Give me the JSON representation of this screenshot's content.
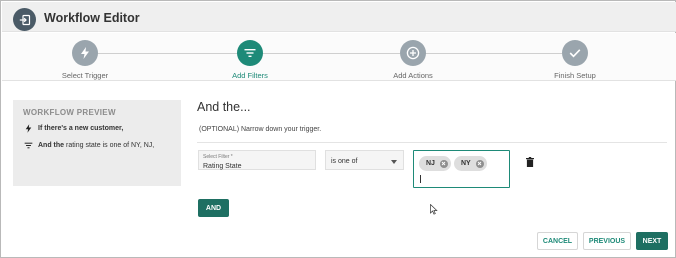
{
  "app": {
    "title": "Workflow Editor"
  },
  "stepper": {
    "steps": [
      {
        "label": "Select Trigger",
        "icon": "lightning-icon",
        "active": false
      },
      {
        "label": "Add Filters",
        "icon": "filter-icon",
        "active": true
      },
      {
        "label": "Add Actions",
        "icon": "plus-circle-icon",
        "active": false
      },
      {
        "label": "Finish Setup",
        "icon": "check-icon",
        "active": false
      }
    ]
  },
  "preview": {
    "title": "WORKFLOW PREVIEW",
    "trigger_text": "If there's a new customer,",
    "filter_prefix": "And the",
    "filter_text": "rating state is one of NY, NJ,"
  },
  "main": {
    "title": "And the...",
    "subtitle": "(OPTIONAL) Narrow down your trigger."
  },
  "filter": {
    "field_label": "Select Filter *",
    "field_value": "Rating State",
    "operator_value": "is one of",
    "chips": [
      "NJ",
      "NY"
    ]
  },
  "buttons": {
    "and": "AND",
    "cancel": "CANCEL",
    "previous": "PREVIOUS",
    "next": "NEXT"
  },
  "colors": {
    "accent": "#1e8a78",
    "accent_dark": "#1e6f62",
    "inactive_step": "#9aa5ad"
  }
}
